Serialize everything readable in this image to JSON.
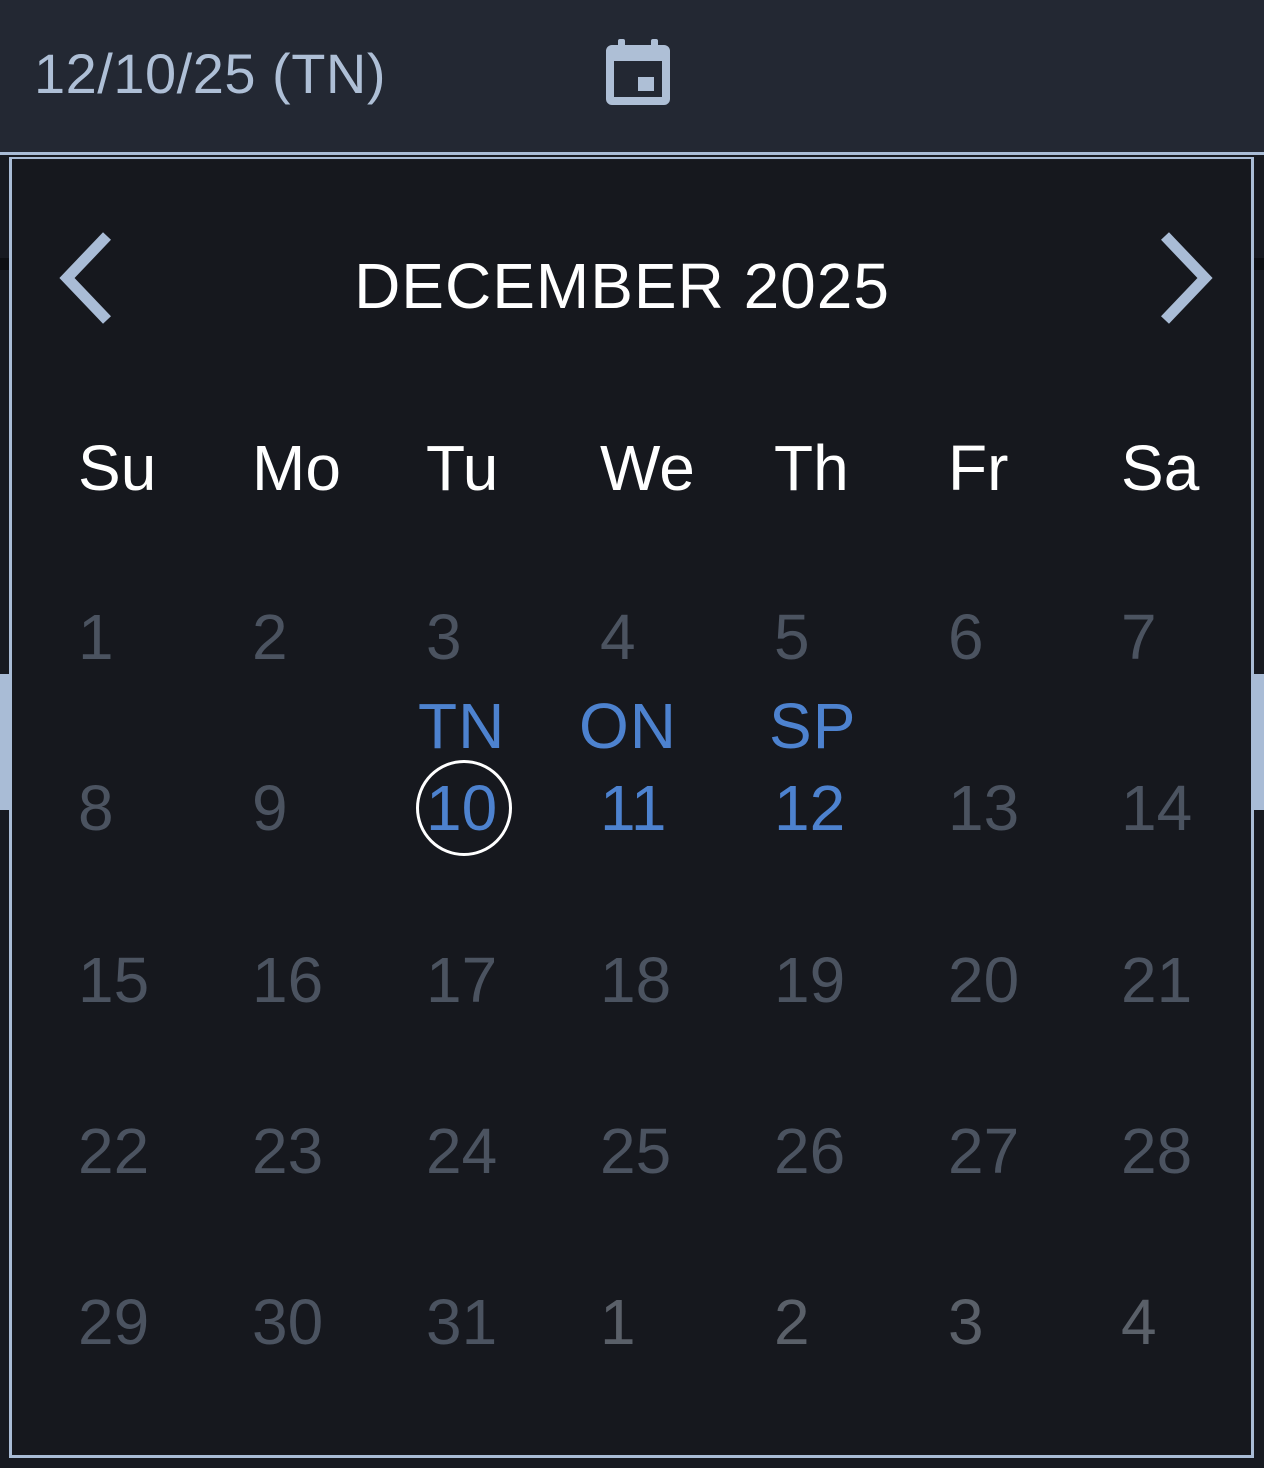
{
  "date_input": {
    "value": "12/10/25 (TN)",
    "icon": "calendar-event-icon"
  },
  "calendar": {
    "month_title": "DECEMBER 2025",
    "prev_icon": "chevron-left-icon",
    "next_icon": "chevron-right-icon",
    "weekdays": [
      "Su",
      "Mo",
      "Tu",
      "We",
      "Th",
      "Fr",
      "Sa"
    ],
    "weeks": [
      [
        "1",
        "2",
        "3",
        "4",
        "5",
        "6",
        "7"
      ],
      [
        "8",
        "9",
        "10",
        "11",
        "12",
        "13",
        "14"
      ],
      [
        "15",
        "16",
        "17",
        "18",
        "19",
        "20",
        "21"
      ],
      [
        "22",
        "23",
        "24",
        "25",
        "26",
        "27",
        "28"
      ],
      [
        "29",
        "30",
        "31",
        "1",
        "2",
        "3",
        "4"
      ]
    ],
    "selected_day": "10",
    "day_labels": {
      "tue_10": "TN",
      "wed_11": "ON",
      "thu_12": "SP"
    }
  },
  "colors": {
    "accent": "#4d82cf",
    "border": "#a9bcd6",
    "header_bg": "#232833",
    "popup_bg": "#16181e",
    "inactive_day": "#4b5360"
  }
}
